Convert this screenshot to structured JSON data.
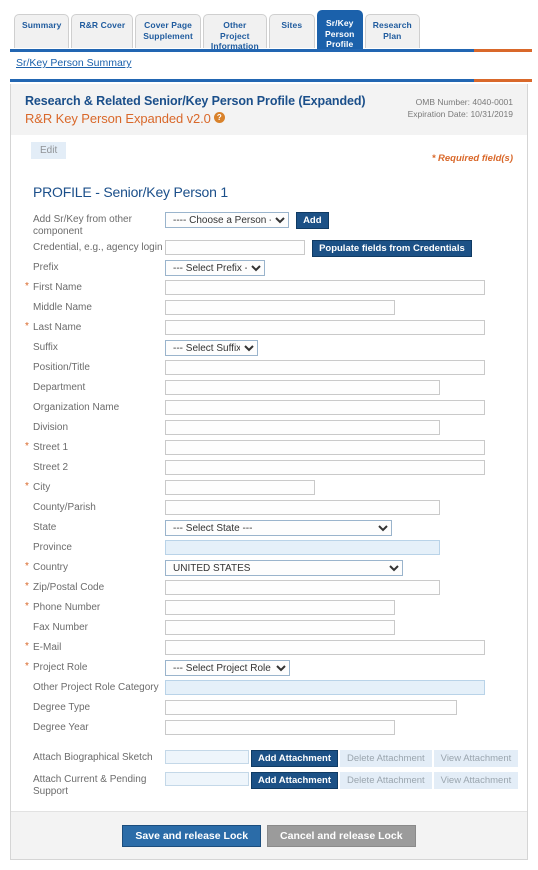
{
  "tabs": [
    {
      "label": "Summary",
      "active": false
    },
    {
      "label": "R&R Cover",
      "active": false
    },
    {
      "label": "Cover Page\nSupplement",
      "active": false
    },
    {
      "label": "Other\nProject\nInformation",
      "active": false
    },
    {
      "label": "Sites",
      "active": false
    },
    {
      "label": "Sr/Key\nPerson\nProfile",
      "active": true
    },
    {
      "label": "Research\nPlan",
      "active": false
    }
  ],
  "breadcrumb": {
    "link": "Sr/Key Person Summary"
  },
  "header": {
    "title": "Research & Related Senior/Key Person Profile (Expanded)",
    "subtitle": "R&R Key Person Expanded v2.0",
    "help_icon": "question-mark-icon",
    "omb_number": "OMB Number: 4040-0001",
    "expiration_date": "Expiration Date:  10/31/2019",
    "edit_label": "Edit",
    "required_note": "* Required field(s)"
  },
  "section": {
    "title": "PROFILE - Senior/Key Person 1"
  },
  "colors": {
    "accent_blue": "#1b61ab",
    "accent_orange": "#d9682a",
    "rule_blue": "#2266b2",
    "button_blue": "#1c5186"
  },
  "fields": {
    "add_from_component": {
      "label": "Add Sr/Key from other component",
      "required": false,
      "select_value": "---- Choose a Person ----",
      "add_button": "Add"
    },
    "credential": {
      "label": "Credential, e.g., agency login",
      "required": false,
      "value": "",
      "populate_button": "Populate fields from Credentials"
    },
    "prefix": {
      "label": "Prefix",
      "required": false,
      "select_value": "--- Select Prefix ---"
    },
    "first_name": {
      "label": "First Name",
      "required": true,
      "value": ""
    },
    "middle_name": {
      "label": "Middle Name",
      "required": false,
      "value": ""
    },
    "last_name": {
      "label": "Last Name",
      "required": true,
      "value": ""
    },
    "suffix": {
      "label": "Suffix",
      "required": false,
      "select_value": "--- Select Suffix ---"
    },
    "position_title": {
      "label": "Position/Title",
      "required": false,
      "value": ""
    },
    "department": {
      "label": "Department",
      "required": false,
      "value": ""
    },
    "organization_name": {
      "label": "Organization Name",
      "required": false,
      "value": ""
    },
    "division": {
      "label": "Division",
      "required": false,
      "value": ""
    },
    "street1": {
      "label": "Street 1",
      "required": true,
      "value": ""
    },
    "street2": {
      "label": "Street 2",
      "required": false,
      "value": ""
    },
    "city": {
      "label": "City",
      "required": true,
      "value": ""
    },
    "county_parish": {
      "label": "County/Parish",
      "required": false,
      "value": ""
    },
    "state": {
      "label": "State",
      "required": false,
      "select_value": "--- Select State ---"
    },
    "province": {
      "label": "Province",
      "required": false,
      "value": "",
      "readonly": true
    },
    "country": {
      "label": "Country",
      "required": true,
      "select_value": "UNITED STATES"
    },
    "zip": {
      "label": "Zip/Postal Code",
      "required": true,
      "value": ""
    },
    "phone": {
      "label": "Phone Number",
      "required": true,
      "value": ""
    },
    "fax": {
      "label": "Fax Number",
      "required": false,
      "value": ""
    },
    "email": {
      "label": "E-Mail",
      "required": true,
      "value": ""
    },
    "project_role": {
      "label": "Project Role",
      "required": true,
      "select_value": "--- Select Project Role ---"
    },
    "other_project_role": {
      "label": "Other Project Role Category",
      "required": false,
      "value": "",
      "readonly": true
    },
    "degree_type": {
      "label": "Degree Type",
      "required": false,
      "value": ""
    },
    "degree_year": {
      "label": "Degree Year",
      "required": false,
      "value": ""
    }
  },
  "attachments": [
    {
      "label": "Attach Biographical Sketch",
      "value": "",
      "add_label": "Add Attachment",
      "delete_label": "Delete Attachment",
      "view_label": "View Attachment"
    },
    {
      "label": "Attach Current & Pending Support",
      "value": "",
      "add_label": "Add Attachment",
      "delete_label": "Delete Attachment",
      "view_label": "View Attachment"
    }
  ],
  "footer": {
    "save_label": "Save and release Lock",
    "cancel_label": "Cancel and release Lock"
  }
}
